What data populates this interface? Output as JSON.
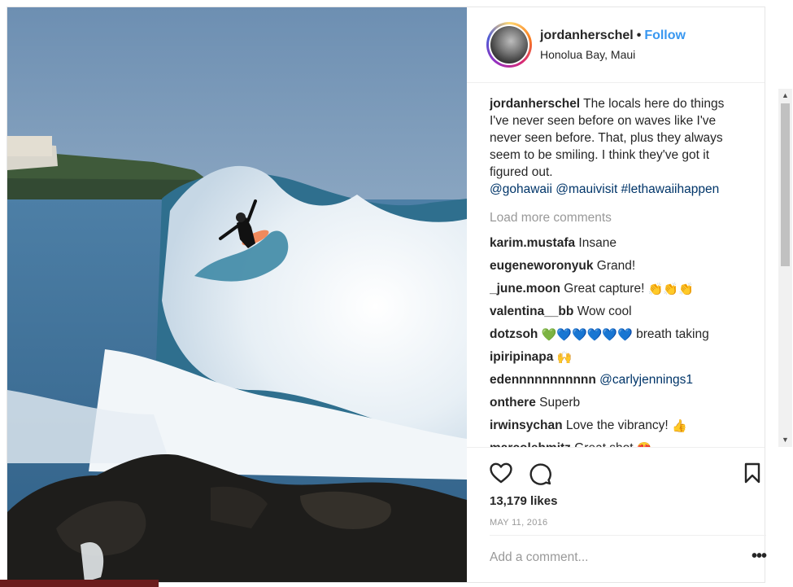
{
  "post": {
    "username": "jordanherschel",
    "follow_label": "Follow",
    "location": "Honolua Bay, Maui",
    "caption": {
      "username": "jordanherschel",
      "text": "The locals here do things I've never seen before on waves like I've never seen before. That, plus they always seem to be smiling. I think they've got it figured out.",
      "tags": "@gohawaii @mauivisit #lethawaiihappen"
    },
    "load_more_label": "Load more comments",
    "comments": [
      {
        "user": "karim.mustafa",
        "text": "Insane",
        "emoji": ""
      },
      {
        "user": "eugeneworonyuk",
        "text": "Grand!",
        "emoji": ""
      },
      {
        "user": "_june.moon",
        "text": "Great capture!",
        "emoji": "👏👏👏"
      },
      {
        "user": "valentina__bb",
        "text": "Wow cool",
        "emoji": ""
      },
      {
        "user": "dotzsoh",
        "text": "breath taking",
        "emoji": "💚💙💙💙💙💙"
      },
      {
        "user": "ipiripinapa",
        "text": "",
        "emoji": "🙌"
      },
      {
        "user": "edennnnnnnnnnn",
        "text": "@carlyjennings1",
        "emoji": ""
      },
      {
        "user": "onthere",
        "text": "Superb",
        "emoji": ""
      },
      {
        "user": "irwinsychan",
        "text": "Love the vibrancy!",
        "emoji": "👍"
      },
      {
        "user": "marcolehmitz",
        "text": "Great shot",
        "emoji": "😍"
      }
    ],
    "likes": "13,179 likes",
    "date": "MAY 11, 2016",
    "add_comment_placeholder": "Add a comment...",
    "more_label": "•••",
    "icons": {
      "like": "heart-icon",
      "comment": "comment-icon",
      "save": "bookmark-icon"
    }
  }
}
